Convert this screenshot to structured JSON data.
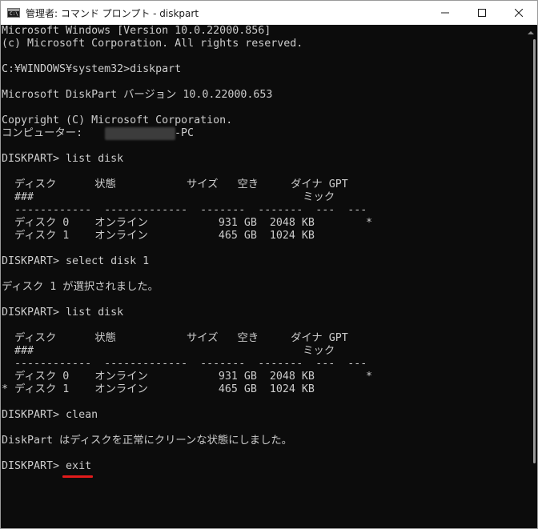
{
  "window": {
    "title": "管理者: コマンド プロンプト - diskpart",
    "icon_label": "C:\\"
  },
  "console": {
    "lines": [
      "Microsoft Windows [Version 10.0.22000.856]",
      "(c) Microsoft Corporation. All rights reserved.",
      "",
      "C:¥WINDOWS¥system32>diskpart",
      "",
      "Microsoft DiskPart バージョン 10.0.22000.653",
      "",
      "Copyright (C) Microsoft Corporation.",
      "コンピューター:",
      "",
      "DISKPART> list disk",
      "",
      "  ディスク      状態           サイズ   空き     ダイナ GPT",
      "  ###                                          ミック",
      "  ------------  -------------  -------  -------  ---  ---",
      "  ディスク 0    オンライン           931 GB  2048 KB        *",
      "  ディスク 1    オンライン           465 GB  1024 KB",
      "",
      "DISKPART> select disk 1",
      "",
      "ディスク 1 が選択されました。",
      "",
      "DISKPART> list disk",
      "",
      "  ディスク      状態           サイズ   空き     ダイナ GPT",
      "  ###                                          ミック",
      "  ------------  -------------  -------  -------  ---  ---",
      "  ディスク 0    オンライン           931 GB  2048 KB        *",
      "* ディスク 1    オンライン           465 GB  1024 KB",
      "",
      "DISKPART> clean",
      "",
      "DiskPart はディスクを正常にクリーンな状態にしました。",
      "",
      "DISKPART> exit"
    ],
    "pc_suffix": "-PC"
  },
  "colors": {
    "console_bg": "#0c0c0c",
    "console_text": "#cccccc",
    "highlight": "#e21b1b"
  }
}
